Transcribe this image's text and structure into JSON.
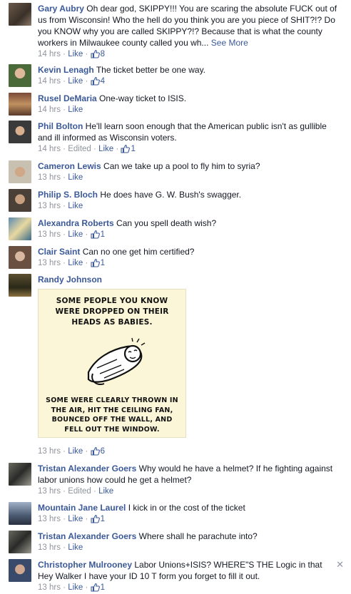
{
  "comments": [
    {
      "name": "Gary Aubry",
      "text": "Oh dear god, SKIPPY!!! You are scaring the absolute FUCK out of us from Wisconsin! Who the hell do you think you are you piece of SHIT?!? Do you KNOW why you are called SKIPPY?!? Because that is what the county workers in Milwaukee county called you wh...",
      "see_more": "See More",
      "time": "14 hrs",
      "like": "Like",
      "likes": "8"
    },
    {
      "name": "Kevin Lenagh",
      "text": "The ticket better be one way.",
      "time": "14 hrs",
      "like": "Like",
      "likes": "4"
    },
    {
      "name": "Rusel DeMaria",
      "text": "One-way ticket to ISIS.",
      "time": "14 hrs",
      "like": "Like"
    },
    {
      "name": "Phil Bolton",
      "text": "He'll learn soon enough that the American public isn't as gullible and ill informed as Wisconsin voters.",
      "time": "14 hrs",
      "edited": "Edited",
      "like": "Like",
      "likes": "1"
    },
    {
      "name": "Cameron Lewis",
      "text": "Can we take up a pool to fly him to syria?",
      "time": "13 hrs",
      "like": "Like"
    },
    {
      "name": "Philip S. Bloch",
      "text": "He does have G. W. Bush's swagger.",
      "time": "13 hrs",
      "like": "Like"
    },
    {
      "name": "Alexandra Roberts",
      "text": "Can you spell death wish?",
      "time": "13 hrs",
      "like": "Like",
      "likes": "1"
    },
    {
      "name": "Clair Saint",
      "text": "Can no one get him certified?",
      "time": "13 hrs",
      "like": "Like",
      "likes": "1"
    },
    {
      "name": "Randy Johnson",
      "text": "",
      "time": "13 hrs",
      "like": "Like",
      "likes": "6",
      "image": {
        "top": "SOME PEOPLE YOU KNOW WERE DROPPED ON THEIR HEADS AS BABIES.",
        "bottom": "SOME WERE CLEARLY THROWN IN THE AIR, HIT THE CEILING FAN, BOUNCED OFF THE WALL, AND FELL OUT THE WINDOW."
      }
    },
    {
      "name": "Tristan Alexander Goers",
      "text": "Why would he have a helmet? If he fighting against labor unions how could he get a helmet?",
      "time": "13 hrs",
      "edited": "Edited",
      "like": "Like"
    },
    {
      "name": "Mountain Jane Laurel",
      "text": "I kick in or the cost of the ticket",
      "time": "13 hrs",
      "like": "Like",
      "likes": "1"
    },
    {
      "name": "Tristan Alexander Goers",
      "text": "Where shall he parachute into?",
      "time": "13 hrs",
      "like": "Like"
    },
    {
      "name": "Christopher Mulrooney",
      "text": "Labor Unions+ISIS? WHERE\"S THE Logic in that Hey Walker I have your ID 10 T form you forget to fill it out.",
      "time": "13 hrs",
      "like": "Like",
      "likes": "1"
    }
  ],
  "meme_lines": {
    "top": [
      "SOME PEOPLE YOU KNOW",
      "WERE DROPPED ON THEIR",
      "HEADS AS BABIES."
    ],
    "bottom": [
      "SOME WERE CLEARLY THROWN IN",
      "THE AIR, HIT THE CEILING FAN,",
      "BOUNCED OFF THE WALL, AND",
      "FELL OUT THE WINDOW."
    ]
  },
  "close_glyph": "✕",
  "colors": {
    "link": "#3b5998",
    "meta": "#90949c",
    "text": "#141823"
  }
}
